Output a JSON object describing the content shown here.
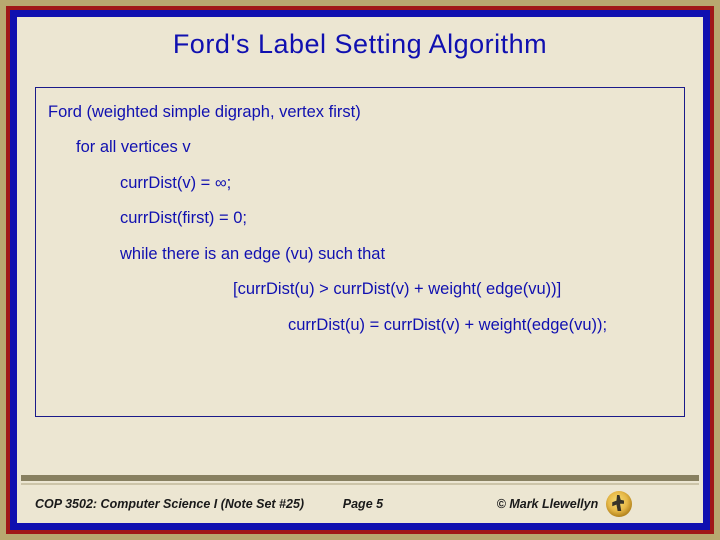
{
  "title": "Ford's Label Setting Algorithm",
  "algo": {
    "l1": "Ford (weighted simple digraph, vertex first)",
    "l2": "for all vertices v",
    "l3": "currDist(v) = ∞;",
    "l4": "currDist(first) = 0;",
    "l5": "while there is an edge (vu) such that",
    "l6": "[currDist(u) > currDist(v) + weight( edge(vu))]",
    "l7": "currDist(u) = currDist(v) + weight(edge(vu));"
  },
  "footer": {
    "course": "COP 3502: Computer Science I  (Note Set #25)",
    "page": "Page 5",
    "copyright": "© Mark Llewellyn"
  }
}
